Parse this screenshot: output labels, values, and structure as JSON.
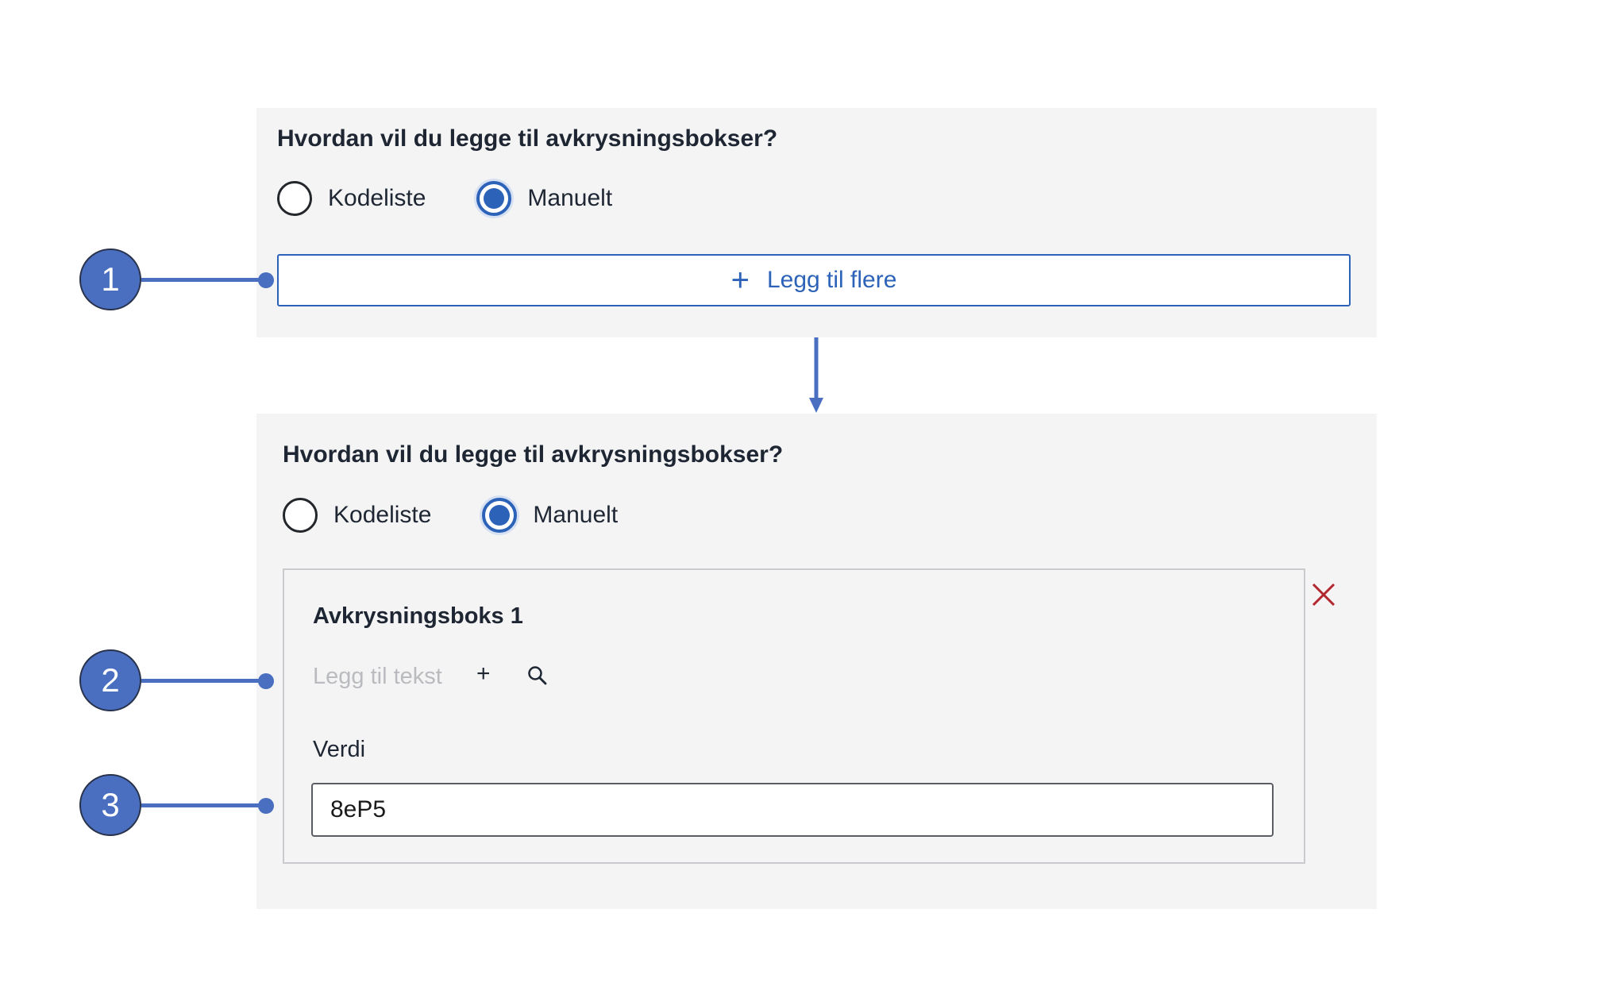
{
  "panel_top": {
    "question": "Hvordan vil du legge til avkrysningsbokser?",
    "options": [
      {
        "label": "Kodeliste",
        "selected": false
      },
      {
        "label": "Manuelt",
        "selected": true
      }
    ],
    "add_more_label": "Legg til flere",
    "add_more_icon": "plus-icon"
  },
  "panel_bottom": {
    "question": "Hvordan vil du legge til avkrysningsbokser?",
    "options": [
      {
        "label": "Kodeliste",
        "selected": false
      },
      {
        "label": "Manuelt",
        "selected": true
      }
    ],
    "card": {
      "title": "Avkrysningsboks 1",
      "text_placeholder": "Legg til tekst",
      "add_icon": "plus-icon",
      "search_icon": "search-icon",
      "value_label": "Verdi",
      "value": "8eP5",
      "remove_icon": "close-icon"
    }
  },
  "callouts": [
    "1",
    "2",
    "3"
  ],
  "colors": {
    "accent": "#2c63b8",
    "callout": "#4a6fc0",
    "panel_bg": "#f4f4f4",
    "remove": "#b3262d"
  }
}
